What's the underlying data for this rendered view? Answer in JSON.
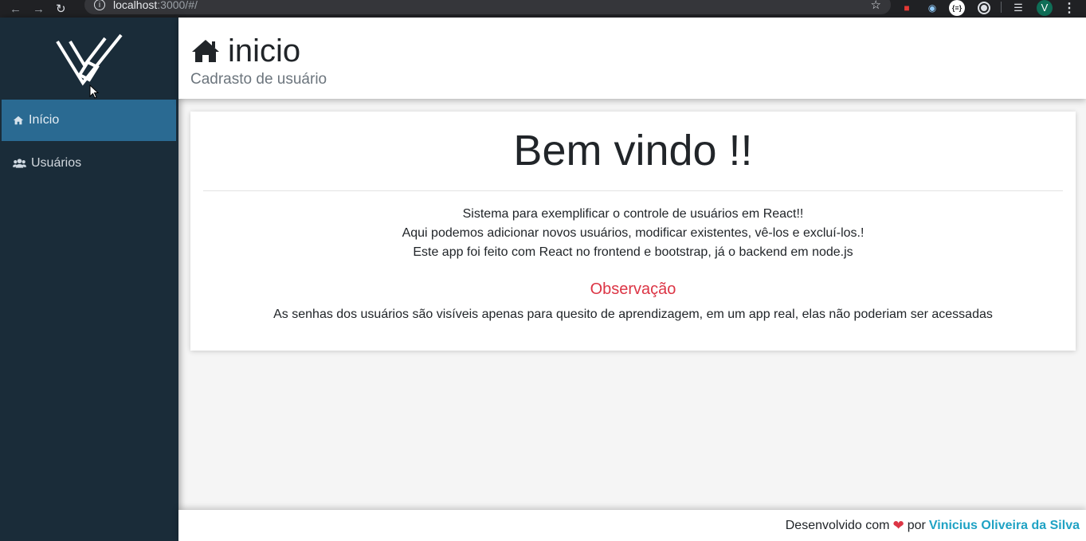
{
  "browser": {
    "url_host": "localhost",
    "url_rest": ":3000/#/",
    "profile_initial": "V",
    "extension_label": "{≡}"
  },
  "sidebar": {
    "items": [
      {
        "label": "Início",
        "icon": "home-icon",
        "active": true
      },
      {
        "label": "Usuários",
        "icon": "users-icon",
        "active": false
      }
    ]
  },
  "header": {
    "title": "inicio",
    "icon": "home-icon",
    "subtitle": "Cadrasto de usuário"
  },
  "main": {
    "welcome": "Bem vindo !!",
    "lines": [
      "Sistema para exemplificar o controle de usuários em React!!",
      "Aqui podemos adicionar novos usuários, modificar existentes, vê-los e excluí-los.!",
      "Este app foi feito com React no frontend e bootstrap, já o backend em node.js"
    ],
    "note_title": "Observação",
    "note_text": "As senhas dos usuários são visíveis apenas para quesito de aprendizagem, em um app real, elas não poderiam ser acessadas"
  },
  "footer": {
    "prefix": "Desenvolvido com",
    "middle": "por",
    "author": "Vinicius Oliveira da Silva"
  },
  "colors": {
    "sidebar_bg": "#1a2c39",
    "active_item": "#2a6a92",
    "note_title": "#dc3545",
    "author_link": "#1fa2c4",
    "heart": "#dc3545"
  }
}
